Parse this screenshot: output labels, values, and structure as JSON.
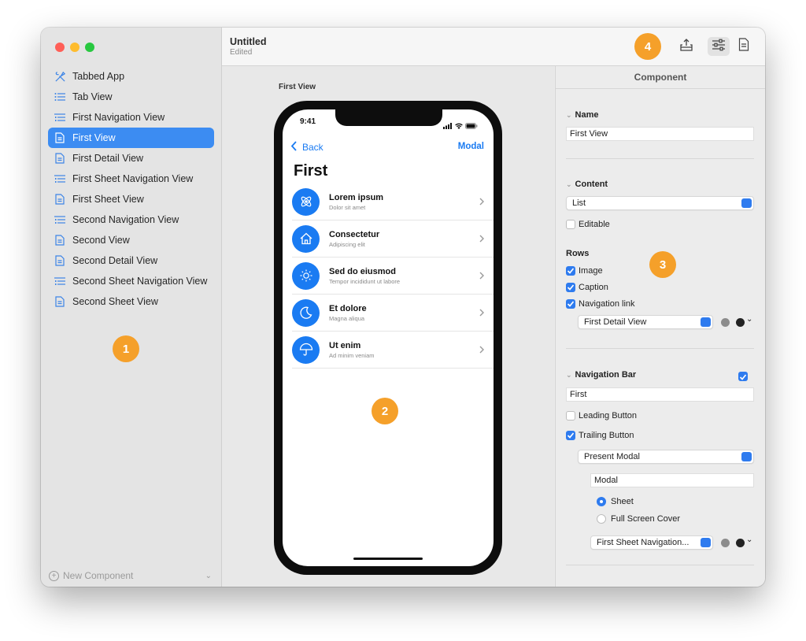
{
  "window": {
    "title": "Untitled",
    "subtitle": "Edited"
  },
  "sidebar": {
    "items": [
      {
        "label": "Tabbed App",
        "icon": "tools-icon",
        "selected": false
      },
      {
        "label": "Tab View",
        "icon": "list-icon",
        "selected": false
      },
      {
        "label": "First Navigation View",
        "icon": "indented-list-icon",
        "selected": false
      },
      {
        "label": "First View",
        "icon": "document-icon",
        "selected": true
      },
      {
        "label": "First Detail View",
        "icon": "document-icon",
        "selected": false
      },
      {
        "label": "First Sheet Navigation View",
        "icon": "indented-list-icon",
        "selected": false
      },
      {
        "label": "First Sheet View",
        "icon": "document-icon",
        "selected": false
      },
      {
        "label": "Second Navigation View",
        "icon": "indented-list-icon",
        "selected": false
      },
      {
        "label": "Second View",
        "icon": "document-icon",
        "selected": false
      },
      {
        "label": "Second Detail View",
        "icon": "document-icon",
        "selected": false
      },
      {
        "label": "Second Sheet Navigation View",
        "icon": "indented-list-icon",
        "selected": false
      },
      {
        "label": "Second Sheet View",
        "icon": "document-icon",
        "selected": false
      }
    ],
    "new_component": "New Component"
  },
  "toolbar": {
    "buttons": [
      "share-icon",
      "sliders-icon",
      "document-icon"
    ]
  },
  "canvas": {
    "preview_label": "First View",
    "phone": {
      "time": "9:41",
      "back": "Back",
      "trailing": "Modal",
      "title": "First",
      "rows": [
        {
          "title": "Lorem ipsum",
          "subtitle": "Dolor sit amet",
          "icon": "atom-icon"
        },
        {
          "title": "Consectetur",
          "subtitle": "Adipiscing elit",
          "icon": "house-icon"
        },
        {
          "title": "Sed do eiusmod",
          "subtitle": "Tempor incididunt ut labore",
          "icon": "sun-icon"
        },
        {
          "title": "Et dolore",
          "subtitle": "Magna aliqua",
          "icon": "moon-icon"
        },
        {
          "title": "Ut enim",
          "subtitle": "Ad minim veniam",
          "icon": "umbrella-icon"
        }
      ]
    }
  },
  "inspector": {
    "header": "Component",
    "name_label": "Name",
    "name_value": "First View",
    "content_label": "Content",
    "content_value": "List",
    "editable_label": "Editable",
    "editable": false,
    "rows_label": "Rows",
    "image_label": "Image",
    "image": true,
    "caption_label": "Caption",
    "caption": true,
    "navlink_label": "Navigation link",
    "navlink": true,
    "navlink_target": "First Detail View",
    "navbar_label": "Navigation Bar",
    "navbar": true,
    "navbar_title": "First",
    "leading_label": "Leading Button",
    "leading": false,
    "trailing_label": "Trailing Button",
    "trailing": true,
    "trailing_action": "Present Modal",
    "trailing_title": "Modal",
    "sheet_label": "Sheet",
    "fullscreen_label": "Full Screen Cover",
    "presentation_selected": "Sheet",
    "modal_target": "First Sheet Navigation..."
  },
  "badges": [
    "1",
    "2",
    "3",
    "4"
  ],
  "colors": {
    "accent": "#3c8cf2",
    "ios_blue": "#1a7bf2",
    "badge": "#f5a02a"
  }
}
